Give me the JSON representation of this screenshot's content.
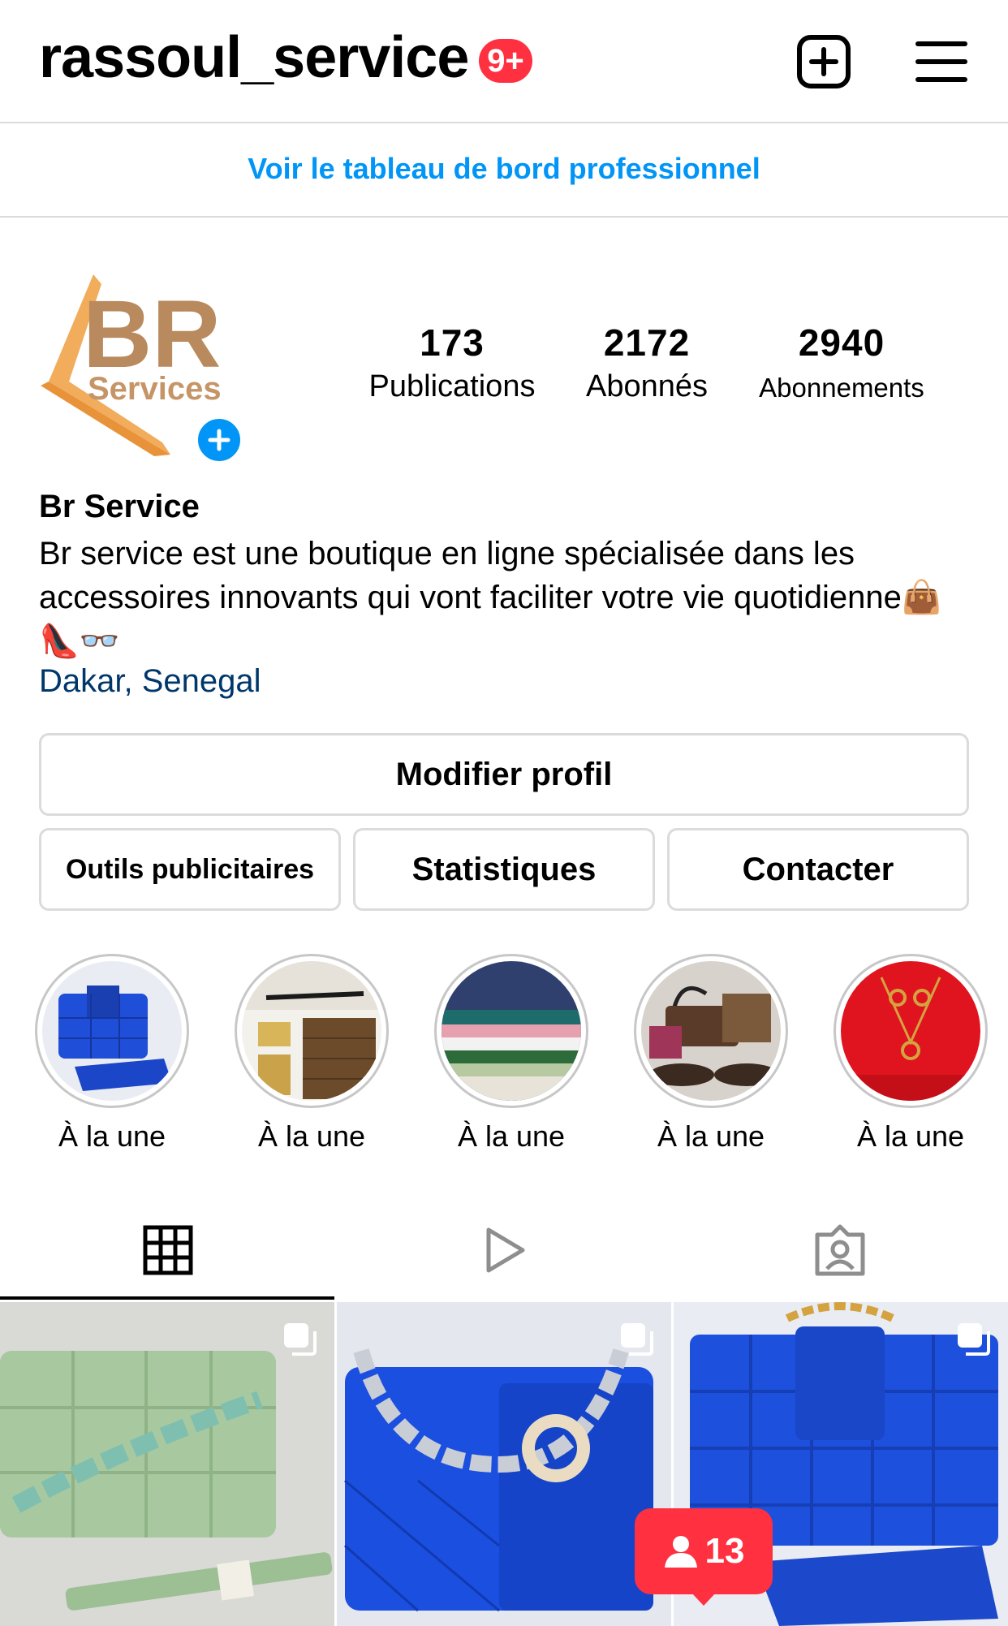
{
  "header": {
    "username": "rassoul_service",
    "notification_badge": "9+",
    "new_post_icon": "plus-square-icon",
    "menu_icon": "hamburger-menu-icon"
  },
  "banner": {
    "dashboard_link": "Voir le tableau de bord professionnel"
  },
  "profile": {
    "logo": {
      "letters": "BR",
      "subtitle": "Services"
    },
    "stats": [
      {
        "value": "173",
        "label": "Publications"
      },
      {
        "value": "2172",
        "label": "Abonnés"
      },
      {
        "value": "2940",
        "label": "Abonnements"
      }
    ],
    "name": "Br Service",
    "bio": "Br service est une boutique en ligne spécialisée dans les accessoires innovants qui vont faciliter votre vie quotidienne👜👠👓",
    "location": "Dakar, Senegal"
  },
  "buttons": {
    "edit_profile": "Modifier profil",
    "ad_tools": "Outils publicitaires",
    "insights": "Statistiques",
    "contact": "Contacter"
  },
  "highlights": [
    {
      "label": "À la une"
    },
    {
      "label": "À la une"
    },
    {
      "label": "À la une"
    },
    {
      "label": "À la une"
    },
    {
      "label": "À la une"
    }
  ],
  "tabs": [
    "grid-icon",
    "reels-icon",
    "tagged-icon"
  ],
  "colors": {
    "accent": "#0095f6",
    "badge": "#ff3040",
    "location": "#00376b"
  },
  "toast": {
    "count": "13"
  }
}
